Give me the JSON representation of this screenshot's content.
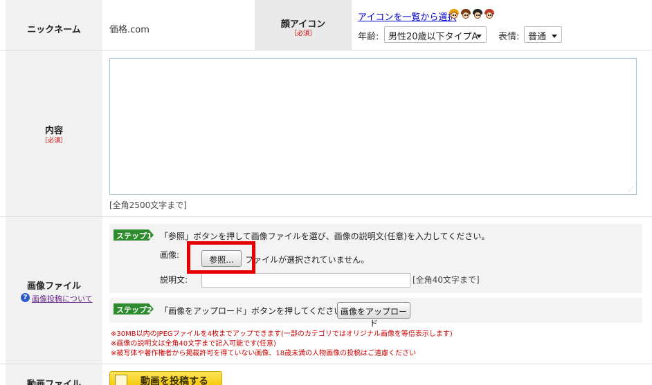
{
  "nickname": {
    "label": "ニックネーム",
    "value": "価格.com"
  },
  "face_icon": {
    "label": "顔アイコン",
    "required": "［必須］",
    "select_link": "アイコンを一覧から選択",
    "age_label": "年齢:",
    "age_value": "男性20歳以下タイプA",
    "expression_label": "表情:",
    "expression_value": "普通",
    "icons": [
      "face-icon-1",
      "face-icon-2",
      "face-icon-3",
      "face-icon-4"
    ]
  },
  "content": {
    "label": "内容",
    "required": "［必須］",
    "value": "",
    "limit": "[全角2500文字まで]"
  },
  "image_file": {
    "label": "画像ファイル",
    "help_link": "画像投稿について",
    "step1": {
      "badge": "ステップ1",
      "instruction": "「参照」ボタンを押して画像ファイルを選び、画像の説明文(任意)を入力してください。",
      "image_label": "画像:",
      "browse_button": "参照...",
      "no_file_text": "ファイルが選択されていません。",
      "desc_label": "説明文:",
      "desc_value": "",
      "desc_limit": "[全角40文字まで]"
    },
    "step2": {
      "badge": "ステップ2",
      "instruction": "「画像をアップロード」ボタンを押してください。",
      "upload_button": "画像をアップロード"
    },
    "notes": [
      "※30MB以内のJPEGファイルを4枚までアップできます(一部のカテゴリではオリジナル画像を等倍表示します)",
      "※画像の説明文は全角40文字まで記入可能です(任意)",
      "※被写体や著作権者から掲載許可を得ていない画像、18歳未満の人物画像の投稿はご遠慮ください"
    ]
  },
  "video_file": {
    "label": "動画ファイル",
    "post_button": "動画を投稿する"
  },
  "colors": {
    "required_red": "#cc0000",
    "link_blue": "#0000cc",
    "step_green": "#2e8b2e",
    "highlight_red": "#e60000",
    "video_yellow": "#f5c800"
  }
}
